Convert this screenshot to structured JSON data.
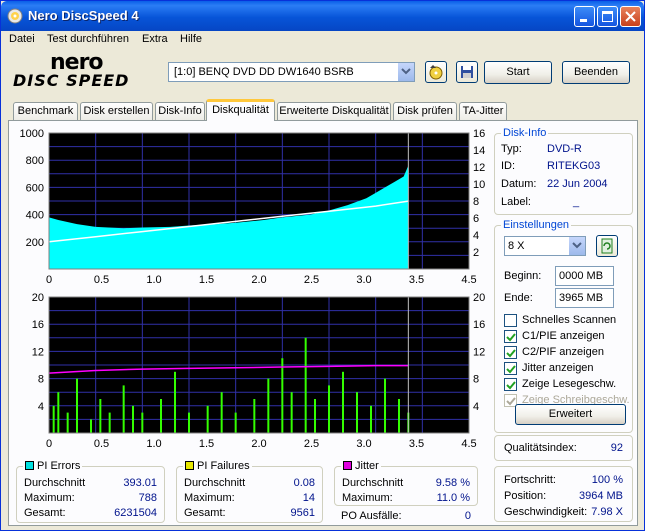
{
  "window": {
    "title": "Nero DiscSpeed 4"
  },
  "menu": [
    "Datei",
    "Test durchführen",
    "Extra",
    "Hilfe"
  ],
  "logo": {
    "line1": "nero",
    "line2": "DISC SPEED"
  },
  "toolbar": {
    "drive": "[1:0]  BENQ DVD DD DW1640 BSRB",
    "start": "Start",
    "stop": "Beenden"
  },
  "tabs": [
    {
      "label": "Benchmark",
      "active": false
    },
    {
      "label": "Disk erstellen",
      "active": false
    },
    {
      "label": "Disk-Info",
      "active": false
    },
    {
      "label": "Diskqualität",
      "active": true
    },
    {
      "label": "Erweiterte Diskqualität",
      "active": false
    },
    {
      "label": "Disk prüfen",
      "active": false
    },
    {
      "label": "TA-Jitter",
      "active": false
    }
  ],
  "disk_info": {
    "caption": "Disk-Info",
    "rows": [
      {
        "label": "Typ:",
        "value": "DVD-R"
      },
      {
        "label": "ID:",
        "value": "RITEKG03"
      },
      {
        "label": "Datum:",
        "value": "22 Jun 2004"
      },
      {
        "label": "Label:",
        "value": "_"
      }
    ]
  },
  "settings": {
    "caption": "Einstellungen",
    "speed": "8 X",
    "begin_label": "Beginn:",
    "begin_value": "0000 MB",
    "end_label": "Ende:",
    "end_value": "3965 MB",
    "checks": [
      {
        "label": "Schnelles Scannen",
        "checked": false,
        "disabled": false
      },
      {
        "label": "C1/PIE anzeigen",
        "checked": true,
        "disabled": false
      },
      {
        "label": "C2/PIF anzeigen",
        "checked": true,
        "disabled": false
      },
      {
        "label": "Jitter anzeigen",
        "checked": true,
        "disabled": false
      },
      {
        "label": "Zeige Lesegeschw.",
        "checked": true,
        "disabled": false
      },
      {
        "label": "Zeige Schreibgeschw.",
        "checked": true,
        "disabled": true
      }
    ],
    "advanced": "Erweitert"
  },
  "quality": {
    "label": "Qualitätsindex:",
    "value": "92"
  },
  "progress": {
    "rows": [
      {
        "label": "Fortschritt:",
        "value": "100 %"
      },
      {
        "label": "Position:",
        "value": "3964 MB"
      },
      {
        "label": "Geschwindigkeit:",
        "value": "7.98 X"
      }
    ]
  },
  "stats": {
    "pi_errors": {
      "caption": "PI Errors",
      "color": "#00e0e0",
      "rows": [
        {
          "label": "Durchschnitt",
          "value": "393.01"
        },
        {
          "label": "Maximum:",
          "value": "788"
        },
        {
          "label": "Gesamt:",
          "value": "6231504"
        }
      ]
    },
    "pi_failures": {
      "caption": "PI Failures",
      "color": "#e8e800",
      "rows": [
        {
          "label": "Durchschnitt",
          "value": "0.08"
        },
        {
          "label": "Maximum:",
          "value": "14"
        },
        {
          "label": "Gesamt:",
          "value": "9561"
        }
      ]
    },
    "jitter": {
      "caption": "Jitter",
      "color": "#e000e0",
      "rows": [
        {
          "label": "Durchschnitt",
          "value": "9.58 %"
        },
        {
          "label": "Maximum:",
          "value": "11.0 %"
        }
      ]
    },
    "po": {
      "label": "PO Ausfälle:",
      "value": "0"
    }
  },
  "chart_data": [
    {
      "type": "area",
      "x_ticks": [
        "0",
        "0.5",
        "1.0",
        "1.5",
        "2.0",
        "2.5",
        "3.0",
        "3.5",
        "4.5"
      ],
      "y_ticks_left": [
        "1000",
        "800",
        "600",
        "400",
        "200"
      ],
      "y_ticks_right": [
        "16",
        "14",
        "12",
        "10",
        "8",
        "6",
        "4",
        "2"
      ],
      "xlim": [
        0,
        4.5
      ],
      "ylim_left": [
        0,
        1000
      ],
      "ylim_right": [
        0,
        16
      ],
      "series": [
        {
          "name": "PI Errors",
          "color": "#00ffff",
          "x": [
            0,
            0.1,
            0.3,
            0.5,
            0.8,
            1.0,
            1.3,
            1.5,
            1.8,
            2.0,
            2.3,
            2.5,
            2.8,
            3.0,
            3.2,
            3.4,
            3.5,
            3.6,
            3.7,
            3.8,
            3.85
          ],
          "y": [
            380,
            360,
            330,
            310,
            300,
            305,
            310,
            320,
            330,
            340,
            360,
            380,
            400,
            430,
            470,
            520,
            560,
            600,
            640,
            680,
            760
          ]
        },
        {
          "name": "Lesegeschw.",
          "color": "#ffffff",
          "axis": "right",
          "x": [
            0,
            0.5,
            1.0,
            1.5,
            2.0,
            2.5,
            3.0,
            3.5,
            3.85
          ],
          "y": [
            3.2,
            3.8,
            4.4,
            5.0,
            5.6,
            6.2,
            6.8,
            7.4,
            7.98
          ]
        }
      ]
    },
    {
      "type": "bar",
      "x_ticks": [
        "0",
        "0.5",
        "1.0",
        "1.5",
        "2.0",
        "2.5",
        "3.0",
        "3.5",
        "4.5"
      ],
      "y_ticks_left": [
        "20",
        "16",
        "12",
        "8",
        "4"
      ],
      "y_ticks_right": [
        "20",
        "16",
        "12",
        "8",
        "4"
      ],
      "xlim": [
        0,
        4.5
      ],
      "ylim": [
        0,
        20
      ],
      "series": [
        {
          "name": "PI Failures",
          "color": "#33ff00",
          "x": [
            0.05,
            0.1,
            0.2,
            0.3,
            0.45,
            0.55,
            0.65,
            0.8,
            0.9,
            1.0,
            1.2,
            1.35,
            1.5,
            1.7,
            1.85,
            2.0,
            2.2,
            2.35,
            2.5,
            2.6,
            2.75,
            2.85,
            3.0,
            3.15,
            3.3,
            3.45,
            3.6,
            3.75,
            3.85
          ],
          "y": [
            4,
            6,
            3,
            8,
            2,
            5,
            3,
            7,
            4,
            3,
            5,
            9,
            3,
            4,
            6,
            3,
            5,
            8,
            11,
            6,
            14,
            5,
            7,
            9,
            6,
            4,
            8,
            5,
            3
          ]
        },
        {
          "name": "Jitter",
          "color": "#ff00ff",
          "x": [
            0,
            0.5,
            1.0,
            1.5,
            2.0,
            2.5,
            3.0,
            3.5,
            3.85
          ],
          "y": [
            8.8,
            9.2,
            9.4,
            9.5,
            9.6,
            9.7,
            9.8,
            9.9,
            9.9
          ]
        }
      ]
    }
  ]
}
